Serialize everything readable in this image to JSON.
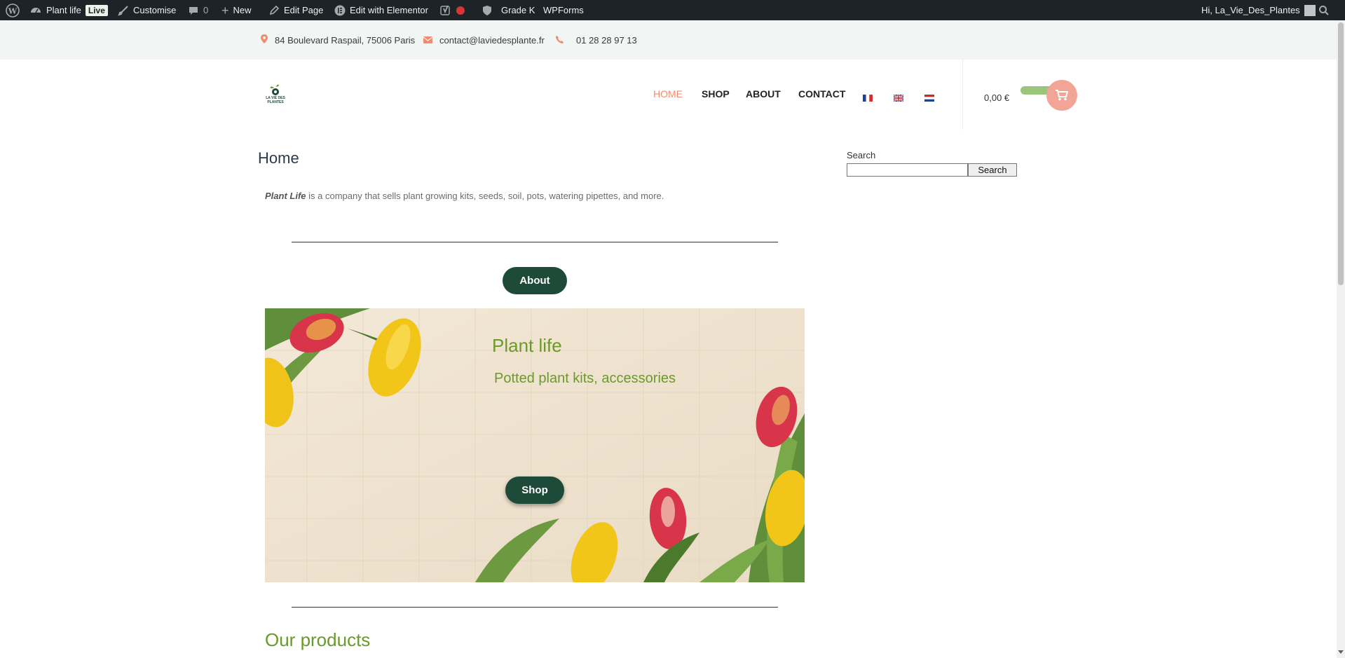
{
  "admin_bar": {
    "site_name": "Plant life",
    "live_badge": "Live",
    "customise": "Customise",
    "comments_count": "0",
    "new": "New",
    "edit_page": "Edit Page",
    "edit_elementor": "Edit with Elementor",
    "grade": "Grade K",
    "wpforms": "WPForms",
    "greeting": "Hi, La_Vie_Des_Plantes"
  },
  "top_info": {
    "address": "84 Boulevard Raspail, 75006 Paris",
    "email": "contact@laviedesplante.fr",
    "phone": "01 28 28 97 13"
  },
  "header": {
    "logo_text": "LA VIE DES PLANTES",
    "nav": [
      "HOME",
      "SHOP",
      "ABOUT",
      "CONTACT"
    ],
    "cart_total": "0,00 €"
  },
  "page": {
    "title": "Home",
    "intro_brand": "Plant Life",
    "intro_text": " is a company that sells plant growing kits, seeds, soil, pots, watering pipettes, and more.",
    "about_button": "About",
    "hero_title": "Plant life",
    "hero_subtitle": "Potted plant kits, accessories",
    "shop_button": "Shop",
    "products_title": "Our products"
  },
  "sidebar": {
    "search_label": "Search",
    "search_value": "",
    "search_button": "Search"
  },
  "colors": {
    "admin_bg": "#1d2327",
    "accent_coral": "#f48a6d",
    "dark_green": "#1e4a3a",
    "leaf_green": "#6a9a2a"
  }
}
